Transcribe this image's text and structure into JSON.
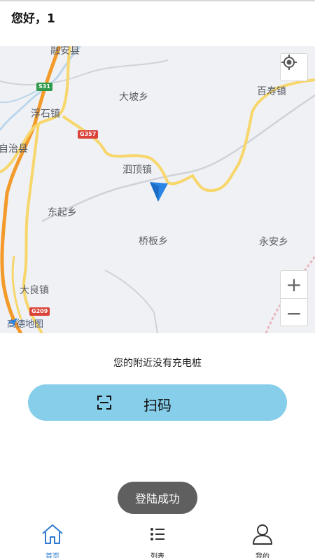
{
  "header": {
    "greeting": "您好，1"
  },
  "map": {
    "places": {
      "rongan": "融安县",
      "dapo": "大坡乡",
      "baishou": "百寿镇",
      "fushi": "浮石镇",
      "zizhixian": "自治县",
      "siding": "泗顶镇",
      "dongqi": "东起乡",
      "qiaoban": "桥板乡",
      "yongan": "永安乡",
      "daliang": "大良镇"
    },
    "shields": {
      "s31": "S31",
      "g357": "G357",
      "g209": "G209"
    },
    "logo_text": "高德地图",
    "zoom_in": "+",
    "zoom_out": "−"
  },
  "status": {
    "nearby_text": "您的附近没有充电桩"
  },
  "scan_button": {
    "label": "扫码"
  },
  "toast": {
    "text": "登陆成功"
  },
  "tabbar": {
    "home": "首页",
    "list": "列表",
    "mine": "我的"
  },
  "colors": {
    "accent": "#87ceeb",
    "active_tab": "#2e7ad1",
    "toast_bg": "#5f5f5f",
    "road_yellow": "#f7d66b",
    "road_orange": "#f39a2a"
  }
}
